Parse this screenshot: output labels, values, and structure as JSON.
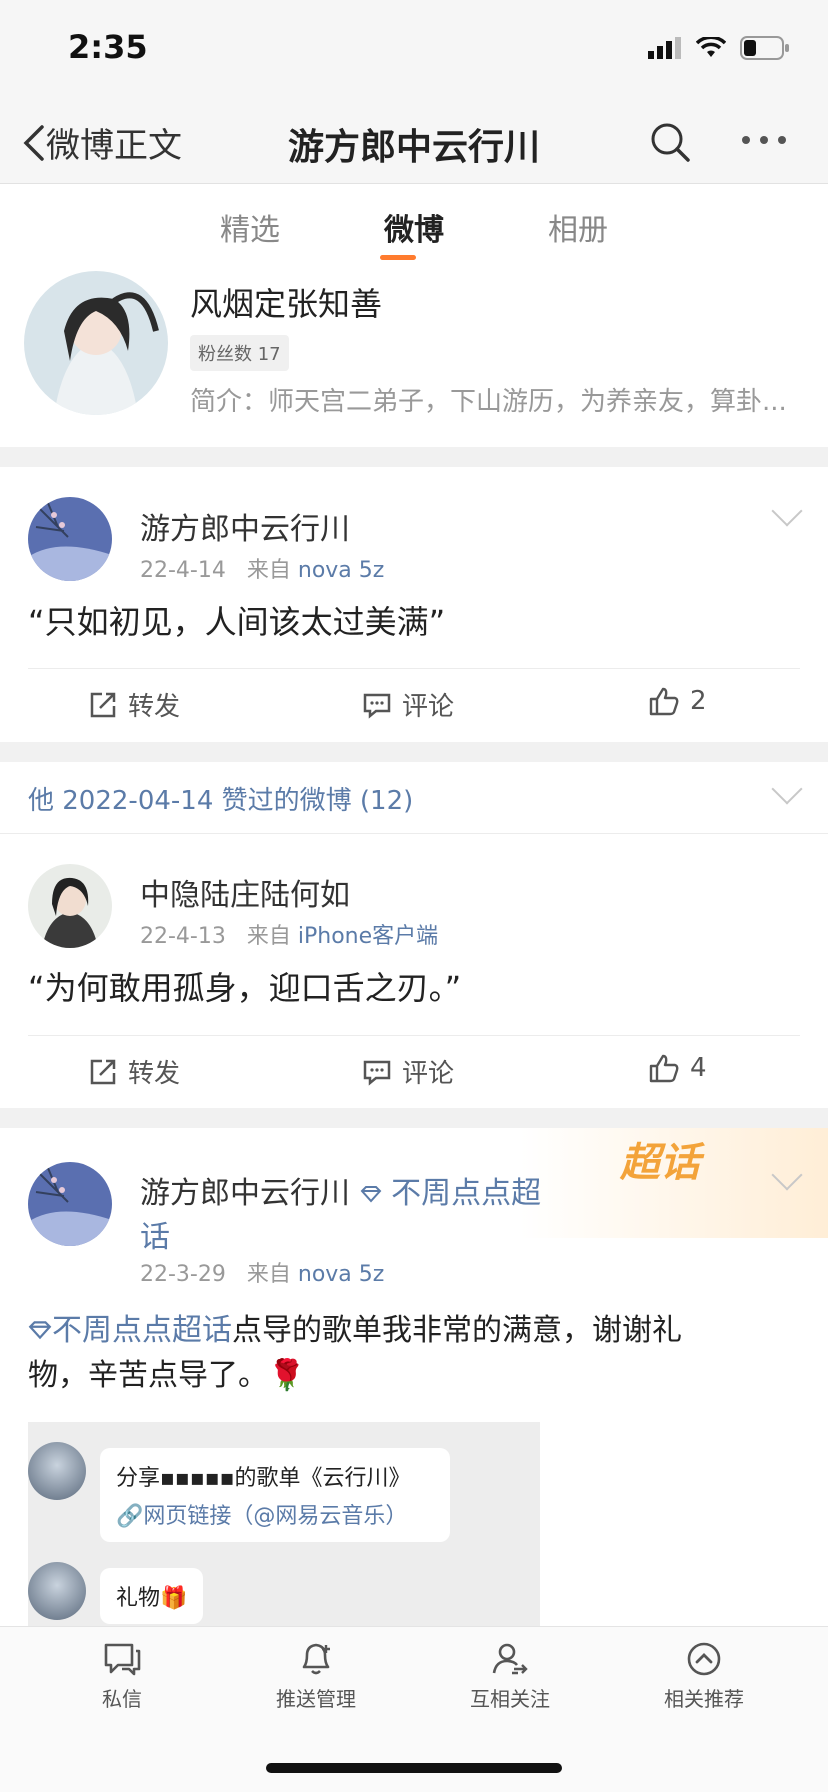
{
  "status": {
    "time": "2:35"
  },
  "nav": {
    "back_label": "微博正文",
    "title": "游方郎中云行川"
  },
  "tabs": [
    "精选",
    "微博",
    "相册"
  ],
  "profile": {
    "name": "风烟定张知善",
    "fans": "粉丝数 17",
    "bio": "简介：师天宫二弟子，下山游历，为养亲友，算卦..."
  },
  "posts": [
    {
      "user": "游方郎中云行川",
      "date": "22-4-14",
      "from": "来自",
      "source": "nova 5z",
      "text": "“只如初见，人间该太过美满”",
      "repost": "转发",
      "comment": "评论",
      "likes": "2"
    },
    {
      "user": "中隐陆庄陆何如",
      "date": "22-4-13",
      "from": "来自",
      "source": "iPhone客户端",
      "text": "“为何敢用孤身，迎口舌之刃。”",
      "repost": "转发",
      "comment": "评论",
      "likes": "4"
    },
    {
      "user": "游方郎中云行川",
      "topic_tag_line1": "不周点点超",
      "topic_tag_line2": "话",
      "date": "22-3-29",
      "from": "来自",
      "source": "nova 5z",
      "topic_link": "不周点点超话",
      "text_rest": "点导的歌单我非常的满意，谢谢礼",
      "text_line2": "物，辛苦点导了。🌹"
    }
  ],
  "liked_header": "他 2022-04-14 赞过的微博 (12)",
  "supertopic_badge": "超话",
  "screenshot": {
    "bubble1_line1": "分享▪▪▪▪▪的歌单《云行川》",
    "bubble1_line2": "🔗网页链接（@网易云音乐）",
    "bubble2": "礼物🎁"
  },
  "bottom_bar": [
    {
      "label": "私信",
      "icon": "message-icon"
    },
    {
      "label": "推送管理",
      "icon": "bell-icon"
    },
    {
      "label": "互相关注",
      "icon": "user-follow-icon"
    },
    {
      "label": "相关推荐",
      "icon": "up-circle-icon"
    }
  ],
  "colors": {
    "accent": "#ff7b2e",
    "link": "#5b7ba8",
    "gap": "#f1f1f1"
  }
}
